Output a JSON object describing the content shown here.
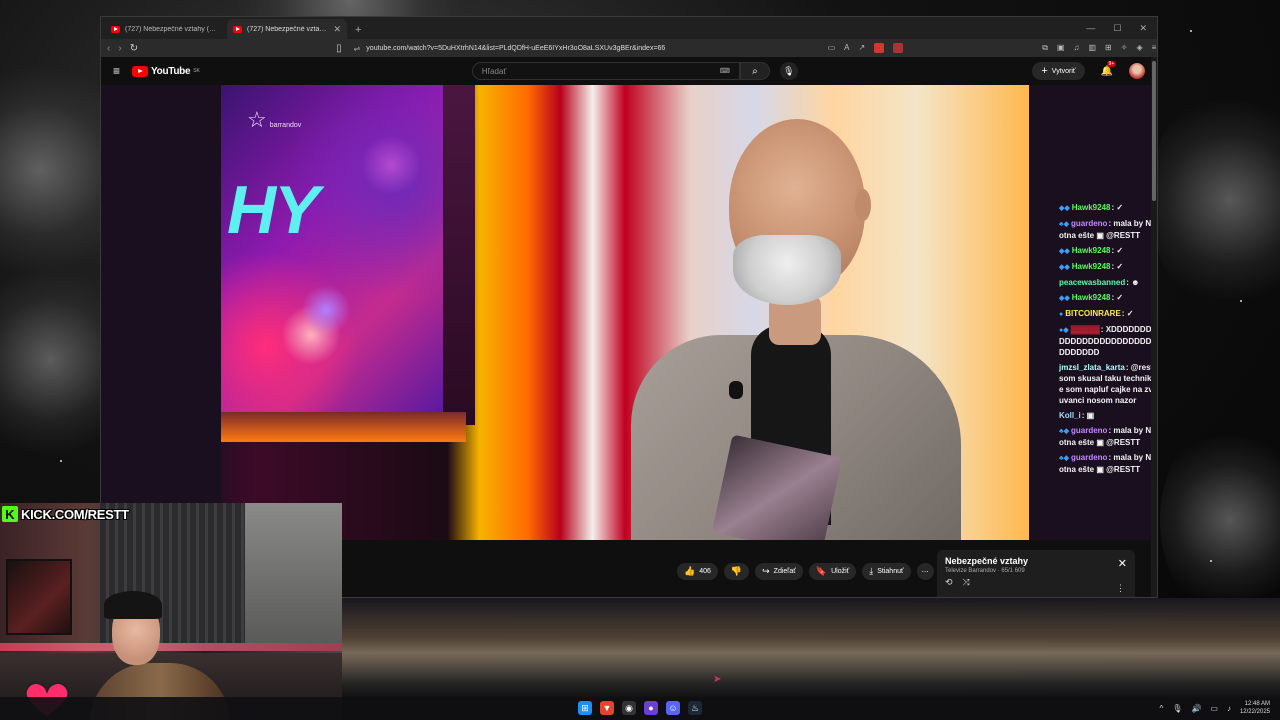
{
  "browser": {
    "tabs": [
      {
        "title": "(727) Nebezpečné vztahy (2025/13)",
        "active": false
      },
      {
        "title": "(727) Nebezpečné vztahy (20…",
        "active": true
      }
    ],
    "new_tab_symbol": "+",
    "window_controls": [
      "—",
      "☐",
      "✕"
    ],
    "url": "youtube.com/watch?v=5DuHXtrhN14&list=PLdQDfH-uEeE6IYxHr3oO8aLSXUv3gBEr&index=66"
  },
  "youtube": {
    "logo_text": "YouTube",
    "logo_region": "SK",
    "search_placeholder": "Hľadať",
    "create_label": "Vytvoriť",
    "notification_count": "9+",
    "actions": {
      "like_count": "406",
      "share_label": "Zdieľať",
      "save_label": "Uložiť",
      "download_label": "Stiahnuť"
    },
    "miniplayer": {
      "title": "Nebezpečné vztahy",
      "subtitle": "Televize Barrandov · 65/1 609"
    }
  },
  "video": {
    "channel_watermark": "barrandov",
    "screen_text": "HY"
  },
  "chat": [
    {
      "nick": "Hawk9248",
      "nick_color": "#55ff55",
      "badges": "◆◆",
      "text": "✓"
    },
    {
      "nick": "guardeno",
      "nick_color": "#c488ff",
      "badges": "♣◆",
      "text": "mala by Naty zajebat ze je tehotna ešte ▣ @RESTT"
    },
    {
      "nick": "Hawk9248",
      "nick_color": "#55ff55",
      "badges": "◆◆",
      "text": "✓"
    },
    {
      "nick": "Hawk9248",
      "nick_color": "#55ff55",
      "badges": "◆◆",
      "text": "✓"
    },
    {
      "nick": "peacewasbanned",
      "nick_color": "#55ffaa",
      "badges": "",
      "text": "☻"
    },
    {
      "nick": "Hawk9248",
      "nick_color": "#55ff55",
      "badges": "◆◆",
      "text": "✓"
    },
    {
      "nick": "BITCOINRARE",
      "nick_color": "#ffee44",
      "badges": "●",
      "text": "✓"
    },
    {
      "nick": "▓▓▓▓▓",
      "nick_color": "#cc2233",
      "badges": "●◆",
      "text": "XDDDDDDDDDDDDDDDDDDDDDDDDDDDDDDDDDDDDDDDDDDDDDDDDDDDDDDDD"
    },
    {
      "nick": "jmzsl_zlata_karta",
      "nick_color": "#aaffff",
      "badges": "",
      "text": "@restt cau miso dneska som skusal taku techniku ze skluzafka akoze som napluf cajke na zvar a jazdil po tom pluvanci nosom nazor"
    },
    {
      "nick": "Koll_i",
      "nick_color": "#aaddff",
      "badges": "",
      "text": "▣"
    },
    {
      "nick": "guardeno",
      "nick_color": "#c488ff",
      "badges": "♣◆",
      "text": "mala by Naty zajebat ze je tehotna ešte ▣ @RESTT"
    },
    {
      "nick": "guardeno",
      "nick_color": "#c488ff",
      "badges": "♣◆",
      "text": "mala by Naty zajebat ze je tehotna ešte ▣ @RESTT"
    }
  ],
  "stream": {
    "kick_url": "KICK.COM/RESTT"
  },
  "taskbar": {
    "time": "12:48 AM",
    "date": "12/22/2025"
  },
  "colors": {
    "youtube_red": "#ff0000",
    "kick_green": "#53fc18",
    "kick_pink": "#ff2e8a"
  }
}
